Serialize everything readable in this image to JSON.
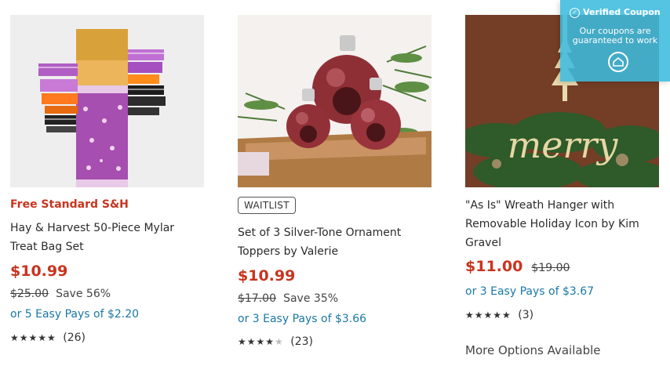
{
  "products": [
    {
      "promo": "Free Standard S&H",
      "title_line1": "Hay & Harvest 50-Piece Mylar",
      "title_line2": "Treat Bag Set",
      "price": "$10.99",
      "was_price": "$25.00",
      "save": "Save 56%",
      "easy_pay": "or 5 Easy Pays of $2.20",
      "rating": 4.5,
      "stars": "★★★★★",
      "review_count": "(26)"
    },
    {
      "badge": "WAITLIST",
      "title_line1": "Set of 3 Silver-Tone Ornament",
      "title_line2": "Toppers by Valerie",
      "price": "$10.99",
      "was_price": "$17.00",
      "save": "Save 35%",
      "easy_pay": "or 3 Easy Pays of $3.66",
      "rating": 4,
      "stars": "★★★★★",
      "review_count": "(23)"
    },
    {
      "title_line1": "\"As Is\" Wreath Hanger with",
      "title_line2": "Removable Holiday Icon by Kim",
      "title_line3": "Gravel",
      "price": "$11.00",
      "was_price": "$19.00",
      "easy_pay": "or 3 Easy Pays of $3.67",
      "rating": 5,
      "stars": "★★★★★",
      "review_count": "(3)",
      "more_options": "More Options Available",
      "image_text": "merry"
    }
  ],
  "coupon": {
    "heading": "Verified Coupon",
    "line1": "Our coupons are",
    "line2": "guaranteed to work",
    "icon": "coupon-logo-icon"
  },
  "colors": {
    "promo": "#c8341f",
    "price": "#c8341f",
    "easy_pay": "#1a78a4",
    "coupon_bg": "#3ebbde"
  }
}
